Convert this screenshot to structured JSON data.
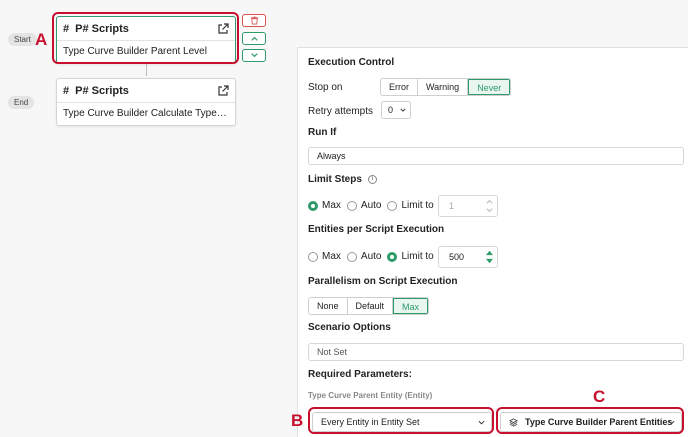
{
  "canvas": {
    "start_label": "Start",
    "end_label": "End",
    "nodes": [
      {
        "type_label": "P# Scripts",
        "name": "Type Curve Builder Parent Level"
      },
      {
        "type_label": "P# Scripts",
        "name": "Type Curve Builder Calculate Type Curv..."
      }
    ]
  },
  "markers": {
    "a": "A",
    "b": "B",
    "c": "C"
  },
  "panel": {
    "execution_control": {
      "heading": "Execution Control",
      "stop_on_label": "Stop on",
      "stop_on_options": [
        "Error",
        "Warning",
        "Never"
      ],
      "stop_on_selected": "Never",
      "retry_label": "Retry attempts",
      "retry_value": "0"
    },
    "run_if": {
      "heading": "Run If",
      "value": "Always"
    },
    "limit_steps": {
      "heading": "Limit Steps",
      "options": [
        "Max",
        "Auto",
        "Limit to"
      ],
      "selected": "Max",
      "limit_value": "1"
    },
    "entities_per_script": {
      "heading": "Entities per Script Execution",
      "options": [
        "Max",
        "Auto",
        "Limit to"
      ],
      "selected": "Limit to",
      "limit_value": "500"
    },
    "parallelism": {
      "heading": "Parallelism on Script Execution",
      "options": [
        "None",
        "Default",
        "Max"
      ],
      "selected": "Max"
    },
    "scenario": {
      "heading": "Scenario Options",
      "value": "Not Set"
    },
    "required": {
      "heading": "Required Parameters:",
      "param_label": "Type Curve Parent Entity (Entity)",
      "mode_value": "Every Entity in Entity Set",
      "entity_set_value": "Type Curve Builder Parent Entities"
    }
  },
  "colors": {
    "accent": "#2f9a6a",
    "danger": "#d9534f",
    "annotation": "#c8102e"
  }
}
